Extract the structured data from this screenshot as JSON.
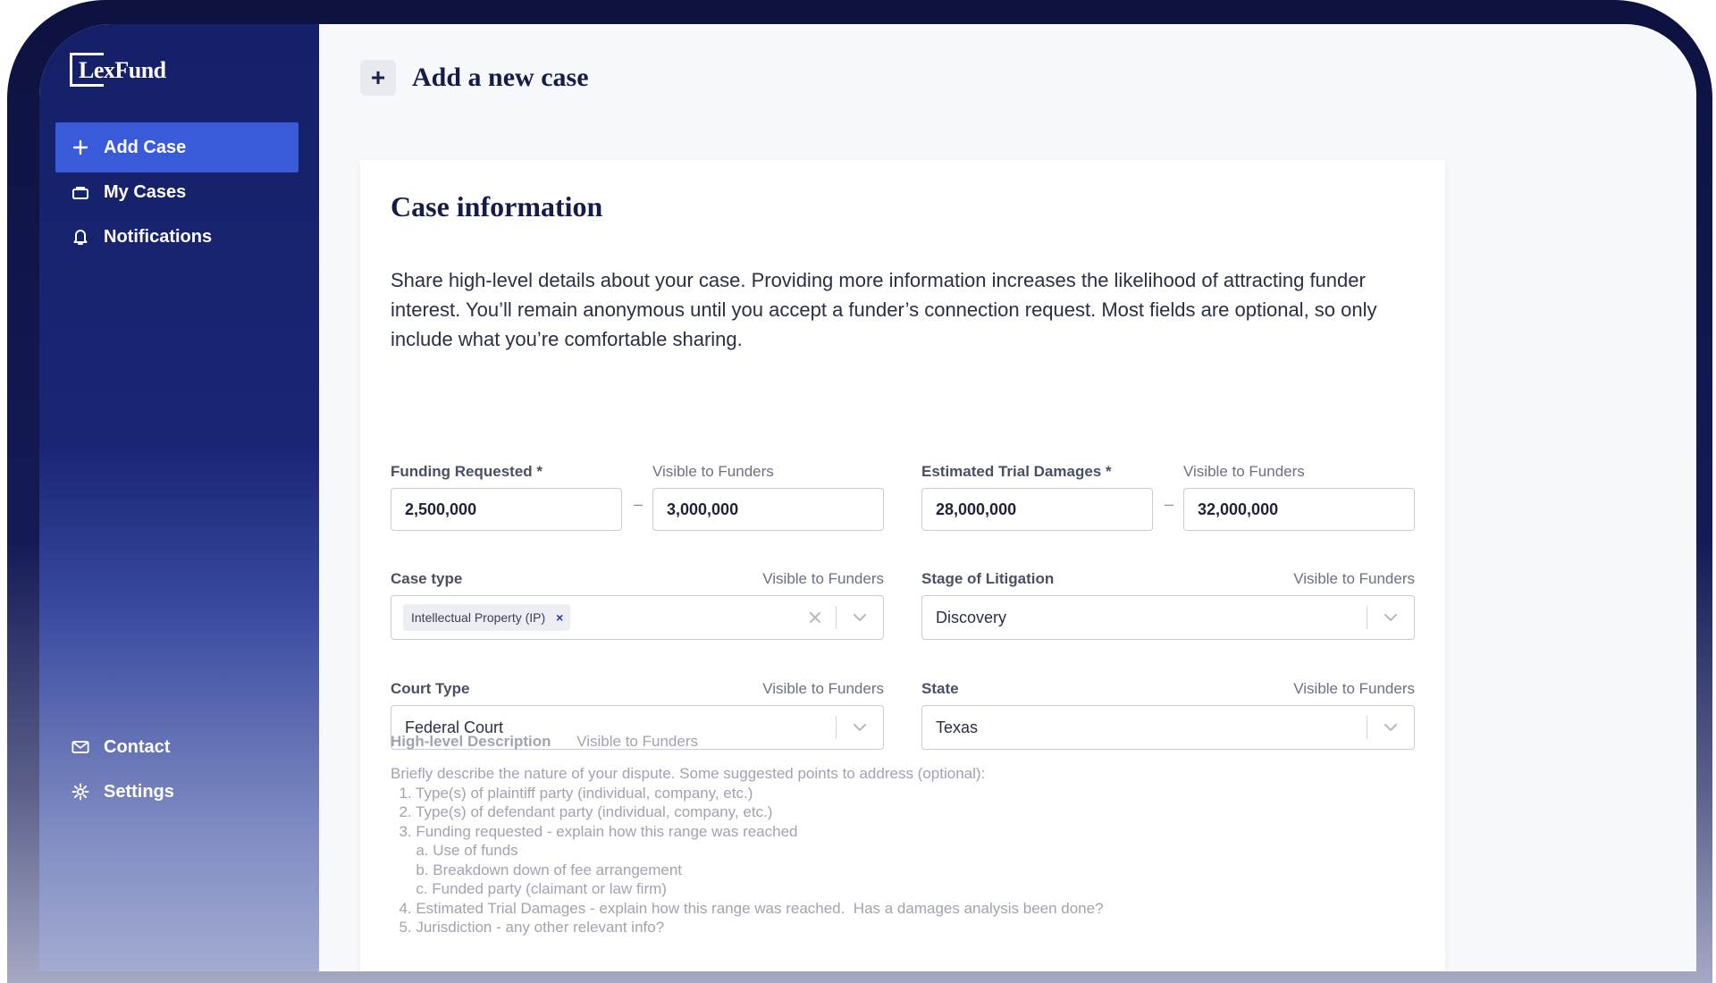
{
  "sidebar": {
    "logo": "LexFund",
    "nav": [
      {
        "label": "Add Case",
        "icon": "plus-icon"
      },
      {
        "label": "My Cases",
        "icon": "briefcase-icon"
      },
      {
        "label": "Notifications",
        "icon": "bell-icon"
      }
    ],
    "footer": [
      {
        "label": "Contact",
        "icon": "mail-icon"
      },
      {
        "label": "Settings",
        "icon": "gear-icon"
      }
    ]
  },
  "header": {
    "plus_glyph": "+",
    "title": "Add a new case"
  },
  "card": {
    "title": "Case information",
    "description": "Share high-level details about your case. Providing more information increases the likelihood of attracting funder interest. You’ll remain anonymous until you accept a funder’s connection request. Most fields are optional, so only include what you’re comfortable sharing."
  },
  "fields": {
    "visible_text": "Visible to Funders",
    "range_dash": "–",
    "funding": {
      "label": "Funding Requested *",
      "min": "2,500,000",
      "max": "3,000,000"
    },
    "damages": {
      "label": "Estimated Trial Damages *",
      "min": "28,000,000",
      "max": "32,000,000"
    },
    "case_type": {
      "label": "Case type",
      "chip": "Intellectual Property (IP)",
      "chip_remove": "×"
    },
    "stage": {
      "label": "Stage of Litigation",
      "value": "Discovery"
    },
    "court_type": {
      "label": "Court Type",
      "value": "Federal Court"
    },
    "state": {
      "label": "State",
      "value": "Texas"
    },
    "description": {
      "label": "High-level Description",
      "placeholder_lines": [
        "Briefly describe the nature of your dispute. Some suggested points to address (optional):",
        "  1. Type(s) of plaintiff party (individual, company, etc.)",
        "  2. Type(s) of defendant party (individual, company, etc.)",
        "  3. Funding requested - explain how this range was reached",
        "      a. Use of funds",
        "      b. Breakdown down of fee arrangement",
        "      c. Funded party (claimant or law firm)",
        "  4. Estimated Trial Damages - explain how this range was reached.  Has a damages analysis been done?",
        "  5. Jurisdiction - any other relevant info?"
      ]
    }
  },
  "colors": {
    "sidebar": "#152068",
    "active_nav": "#3a5bd9",
    "title": "#141c48"
  }
}
